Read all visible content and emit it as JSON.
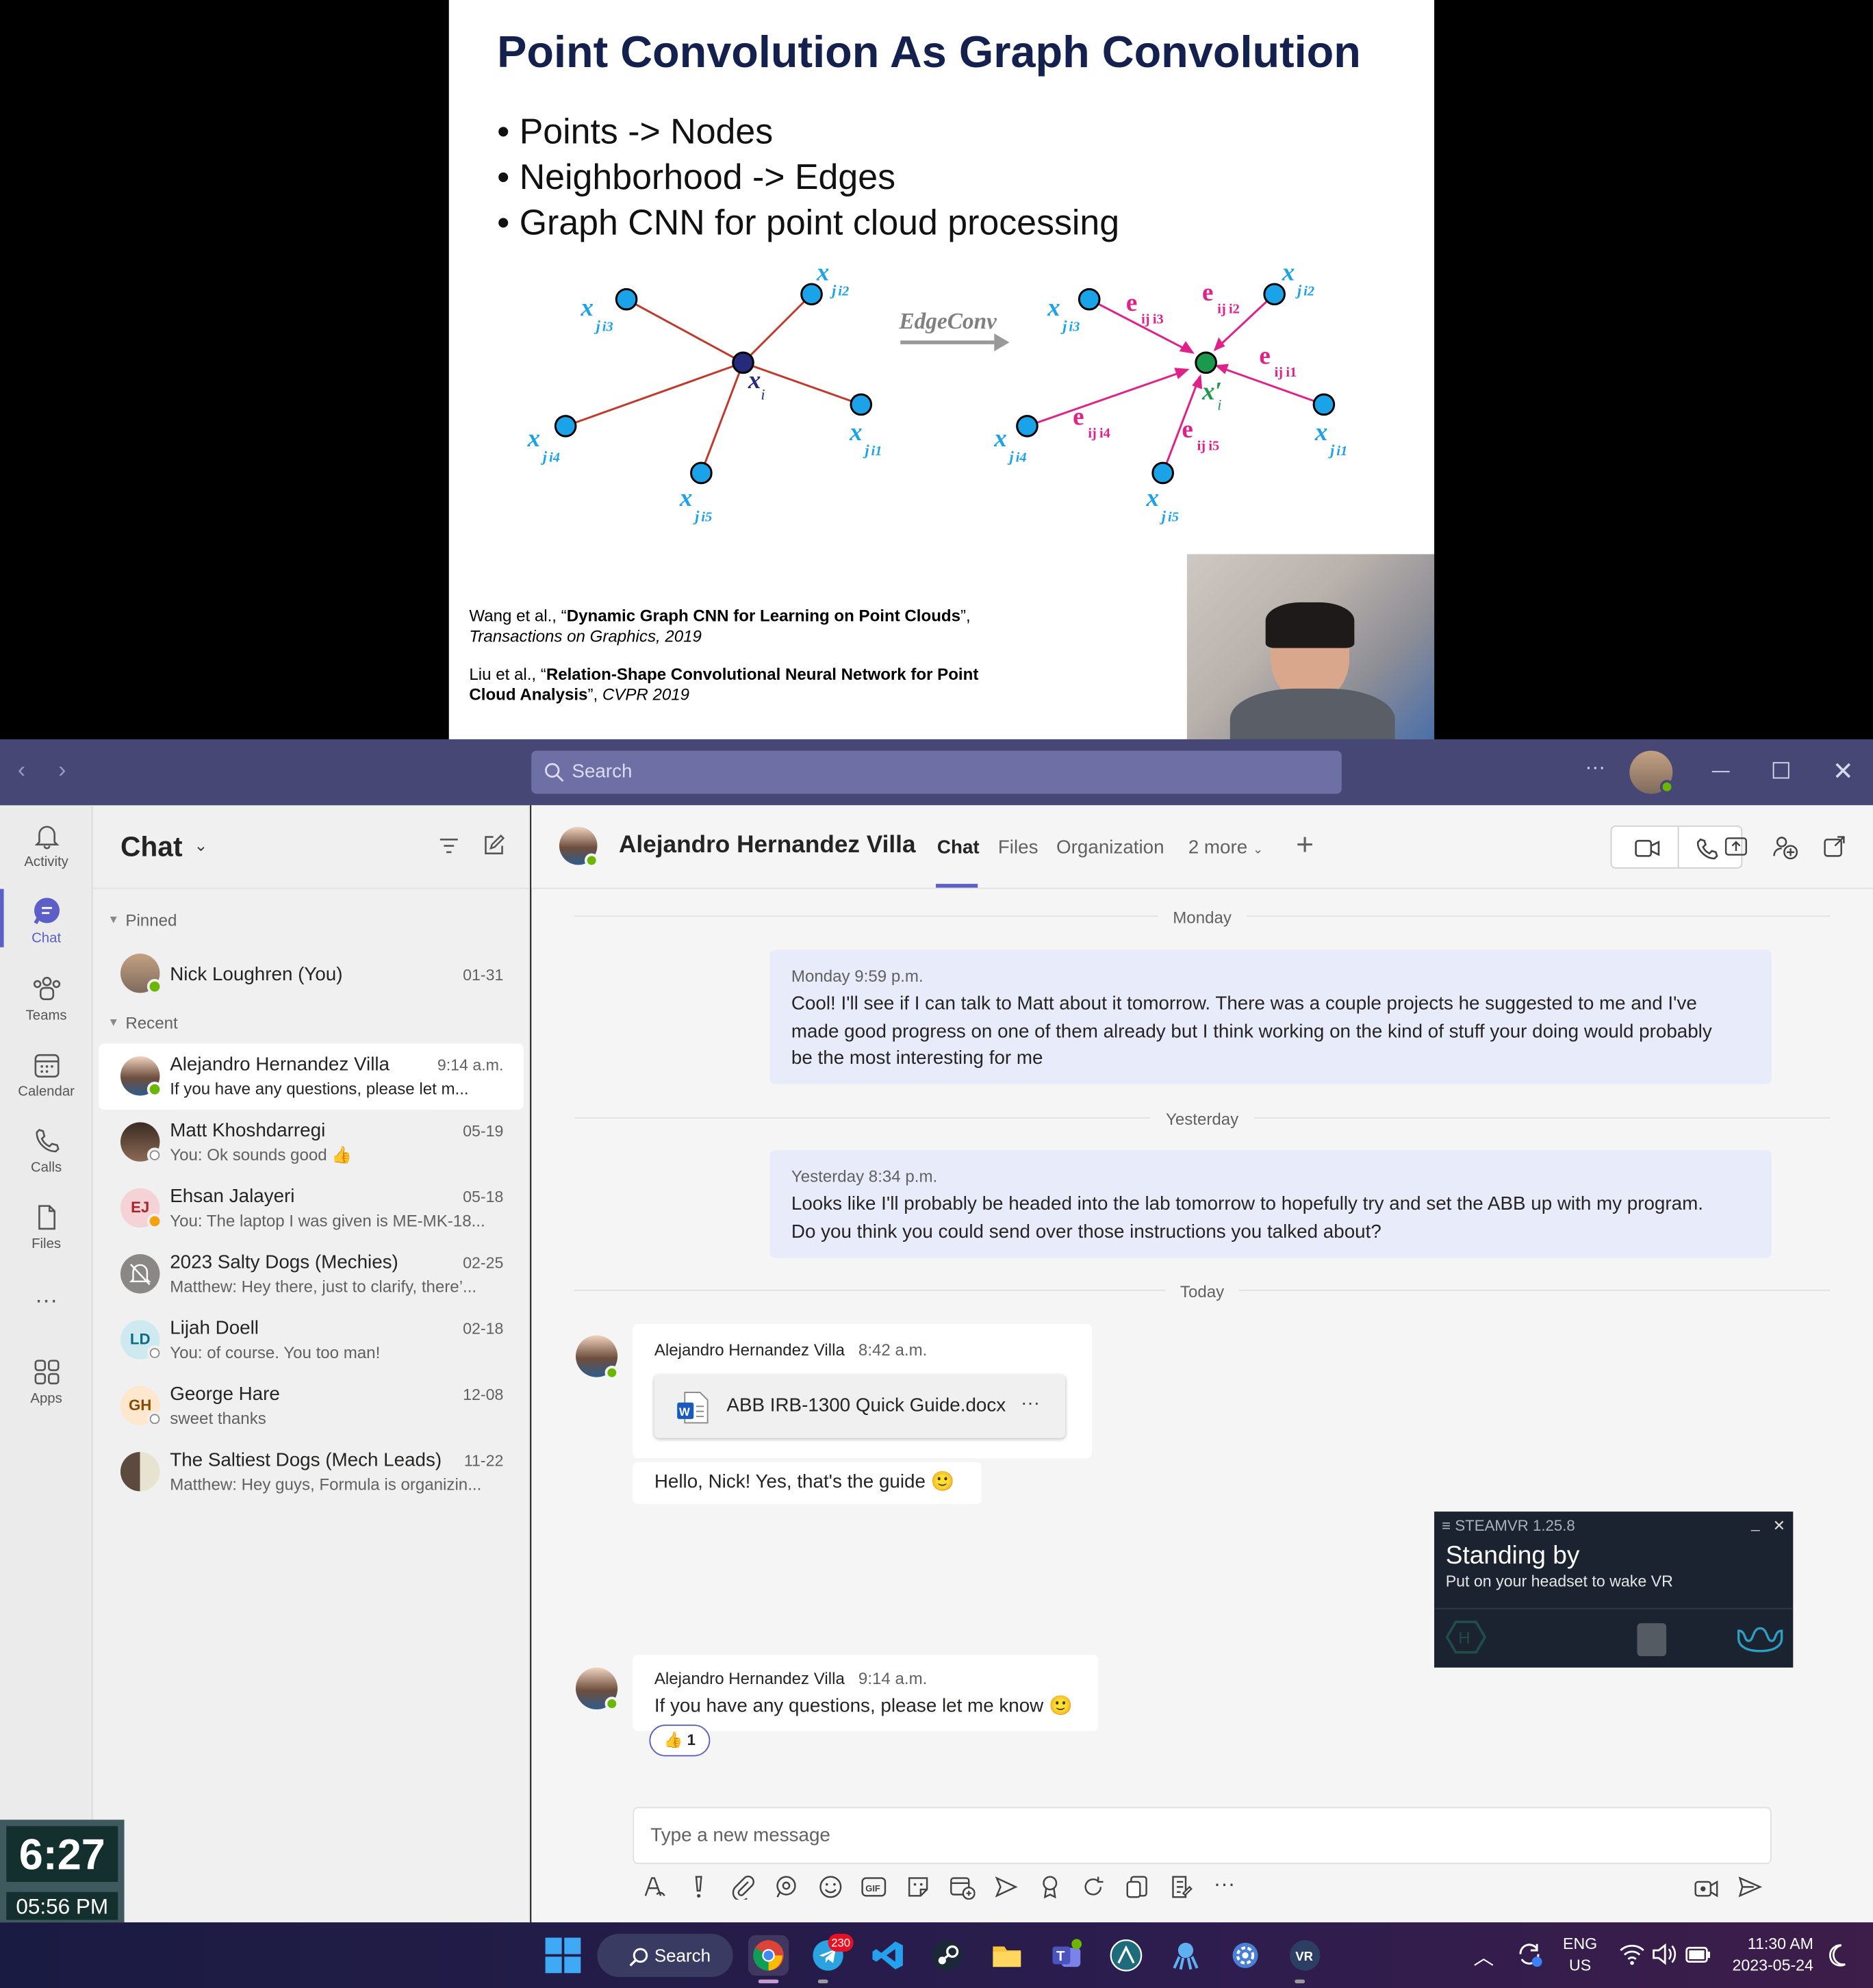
{
  "slide": {
    "title": "Point Convolution As Graph Convolution",
    "bullets": [
      "• Points -> Nodes",
      "• Neighborhood -> Edges",
      "• Graph CNN for point cloud processing"
    ],
    "diagram_arrow_label": "EdgeConv",
    "ref1_prefix": "Wang et al., “",
    "ref1_bold": "Dynamic Graph CNN for Learning on Point Clouds",
    "ref1_suffix": "”,",
    "ref1_venue": "Transactions on Graphics, 2019",
    "ref2_prefix": "Liu et al., “",
    "ref2_bold_a": "Relation-Shape Convolutional Neural Network for Point",
    "ref2_bold_b": "Cloud Analysis",
    "ref2_suffix": "”, ",
    "ref2_venue": "CVPR 2019"
  },
  "titlebar": {
    "search_placeholder": "Search",
    "more": "···"
  },
  "rail": {
    "items": [
      {
        "label": "Activity",
        "icon": "bell-icon"
      },
      {
        "label": "Chat",
        "icon": "chat-icon"
      },
      {
        "label": "Teams",
        "icon": "teams-icon"
      },
      {
        "label": "Calendar",
        "icon": "calendar-icon"
      },
      {
        "label": "Calls",
        "icon": "phone-icon"
      },
      {
        "label": "Files",
        "icon": "file-icon"
      },
      {
        "label": "···",
        "icon": "more-icon"
      },
      {
        "label": "Apps",
        "icon": "apps-icon"
      }
    ]
  },
  "chatlist": {
    "title": "Chat",
    "pinned_label": "Pinned",
    "recent_label": "Recent",
    "pinned": [
      {
        "name": "Nick Loughren (You)",
        "date": "01-31",
        "preview": ""
      }
    ],
    "recent": [
      {
        "name": "Alejandro Hernandez Villa",
        "date": "9:14 a.m.",
        "preview": "If you have any questions, please let m...",
        "initials": ""
      },
      {
        "name": "Matt Khoshdarregi",
        "date": "05-19",
        "preview": "You: Ok sounds good 👍",
        "initials": ""
      },
      {
        "name": "Ehsan Jalayeri",
        "date": "05-18",
        "preview": "You: The laptop I was given is ME-MK-18...",
        "initials": "EJ"
      },
      {
        "name": "2023 Salty Dogs (Mechies)",
        "date": "02-25",
        "preview": "Matthew: Hey there, just to clarify, there’...",
        "initials": ""
      },
      {
        "name": "Lijah Doell",
        "date": "02-18",
        "preview": "You: of course. You too man!",
        "initials": "LD"
      },
      {
        "name": "George Hare",
        "date": "12-08",
        "preview": "sweet thanks",
        "initials": "GH"
      },
      {
        "name": "The Saltiest Dogs (Mech Leads)",
        "date": "11-22",
        "preview": "Matthew: Hey guys, Formula is organizin...",
        "initials": ""
      }
    ]
  },
  "conversation": {
    "name": "Alejandro Hernandez Villa",
    "tabs": [
      "Chat",
      "Files",
      "Organization",
      "2 more"
    ],
    "days": [
      "Monday",
      "Yesterday",
      "Today"
    ],
    "msg1_meta": "Monday 9:59 p.m.",
    "msg1_lines": [
      "Cool! I'll see if I can talk to Matt about it tomorrow. There was a couple projects he suggested to me and I've",
      "made good progress on one of  them already but I think working on the kind of stuff your doing would probably",
      "be the most interesting for me"
    ],
    "msg2_meta": "Yesterday 8:34 p.m.",
    "msg2_lines": [
      "Looks like I'll probably be headed into the lab tomorrow to hopefully try and set the ABB up with my program.",
      "Do you think you could send over those instructions you talked about?"
    ],
    "msg3_sender": "Alejandro Hernandez Villa",
    "msg3_time": "8:42 a.m.",
    "file_name": "ABB IRB-1300 Quick Guide.docx",
    "file_more": "···",
    "msg3_text": "Hello, Nick! Yes, that's the guide 🙂",
    "msg4_sender": "Alejandro Hernandez Villa",
    "msg4_time": "9:14 a.m.",
    "msg4_text": "If you have any questions, please let me know 🙂",
    "reaction_emoji": "👍",
    "reaction_count": "1",
    "composer_placeholder": "Type a new message"
  },
  "steamvr": {
    "title": "STEAMVR 1.25.8",
    "heading": "Standing by",
    "sub": "Put on your headset to wake VR"
  },
  "clock_widget": {
    "timer": "6:27",
    "time": "05:56 PM"
  },
  "taskbar": {
    "search_label": "Search",
    "telegram_badge": "230",
    "lang1": "ENG",
    "lang2": "US",
    "time": "11:30 AM",
    "date": "2023-05-24"
  },
  "colors": {
    "teams_purple": "#464775",
    "accent": "#5b5fc7",
    "presence_green": "#6bb700"
  }
}
